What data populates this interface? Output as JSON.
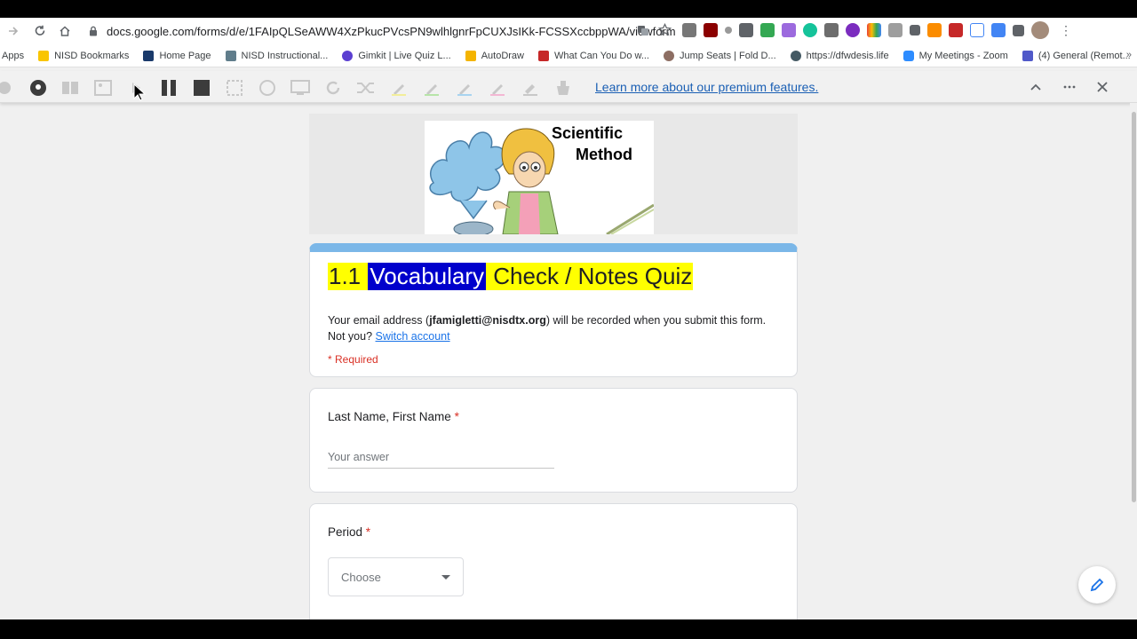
{
  "browser": {
    "url": "docs.google.com/forms/d/e/1FAIpQLSeAWW4XzPkucPVcsPN9wlhlgnrFpCUXJsIKk-FCSSXccbppWA/viewform"
  },
  "bookmarks": [
    {
      "label": "Apps",
      "color": "#4285f4"
    },
    {
      "label": "NISD Bookmarks",
      "color": "#f9c500"
    },
    {
      "label": "Home Page",
      "color": "#1a3a6b"
    },
    {
      "label": "NISD Instructional...",
      "color": "#607d8b"
    },
    {
      "label": "Gimkit | Live Quiz L...",
      "color": "#5b3fd1"
    },
    {
      "label": "AutoDraw",
      "color": "#f4b400"
    },
    {
      "label": "What Can You Do w...",
      "color": "#c62828"
    },
    {
      "label": "Jump Seats | Fold D...",
      "color": "#8d6e63"
    },
    {
      "label": "https://dfwdesis.life",
      "color": "#455a64"
    },
    {
      "label": "My Meetings - Zoom",
      "color": "#2d8cff"
    },
    {
      "label": "(4) General (Remot...",
      "color": "#5059c9"
    }
  ],
  "extension_bar": {
    "premium_link": "Learn more about our premium features."
  },
  "form": {
    "title_parts": {
      "part1": "1.1 ",
      "part2": "Vocabulary",
      "part3": " Check / Notes Quiz"
    },
    "email_prefix": "Your email address (",
    "email": "jfamigletti@nisdtx.org",
    "email_suffix": ") will be recorded when you submit this form.",
    "not_you": "Not you? ",
    "switch_account": "Switch account",
    "required_note": "* Required",
    "header_image_text": {
      "line1": "Scientific",
      "line2": "Method"
    },
    "questions": [
      {
        "label": "Last Name, First Name",
        "placeholder": "Your answer"
      },
      {
        "label": "Period",
        "select_value": "Choose"
      }
    ],
    "required_star": "*"
  },
  "colors": {
    "accent_bar": "#7bb7e8",
    "highlight_yellow": "#ffff00",
    "highlight_blue": "#0000cc",
    "link": "#1a73e8",
    "required": "#d93025"
  }
}
